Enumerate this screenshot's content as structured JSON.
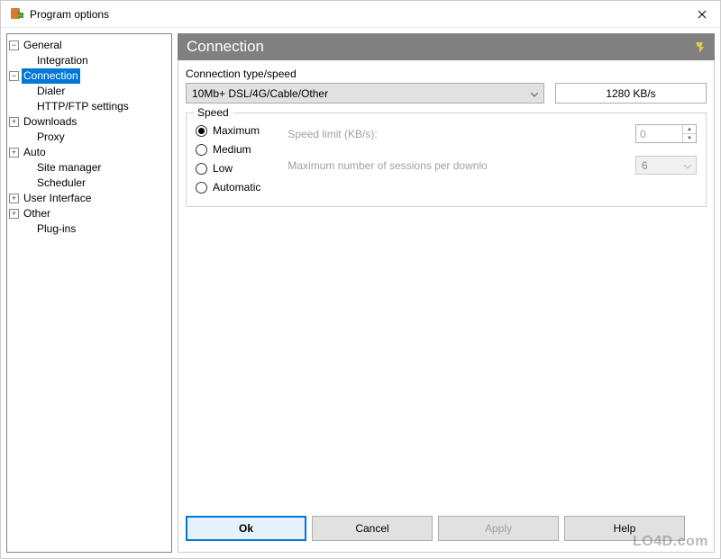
{
  "window": {
    "title": "Program options"
  },
  "tree": {
    "items": [
      {
        "label": "General",
        "depth": 0,
        "expander": "−"
      },
      {
        "label": "Integration",
        "depth": 1,
        "expander": ""
      },
      {
        "label": "Connection",
        "depth": 0,
        "expander": "−",
        "selected": true
      },
      {
        "label": "Dialer",
        "depth": 1,
        "expander": ""
      },
      {
        "label": "HTTP/FTP settings",
        "depth": 1,
        "expander": ""
      },
      {
        "label": "Downloads",
        "depth": 0,
        "expander": "+"
      },
      {
        "label": "Proxy",
        "depth": 1,
        "expander": ""
      },
      {
        "label": "Auto",
        "depth": 0,
        "expander": "+"
      },
      {
        "label": "Site manager",
        "depth": 1,
        "expander": ""
      },
      {
        "label": "Scheduler",
        "depth": 1,
        "expander": ""
      },
      {
        "label": "User Interface",
        "depth": 0,
        "expander": "+"
      },
      {
        "label": "Other",
        "depth": 0,
        "expander": "+"
      },
      {
        "label": "Plug-ins",
        "depth": 1,
        "expander": ""
      }
    ]
  },
  "header": {
    "title": "Connection"
  },
  "connType": {
    "label": "Connection type/speed",
    "value": "10Mb+ DSL/4G/Cable/Other",
    "rate": "1280 KB/s"
  },
  "speed": {
    "legend": "Speed",
    "options": [
      {
        "label": "Maximum",
        "selected": true
      },
      {
        "label": "Medium",
        "selected": false
      },
      {
        "label": "Low",
        "selected": false
      },
      {
        "label": "Automatic",
        "selected": false
      }
    ],
    "limitLabel": "Speed limit (KB/s):",
    "limitValue": "0",
    "sessionsLabel": "Maximum number of sessions per downlo",
    "sessionsValue": "6"
  },
  "buttons": {
    "ok": "Ok",
    "cancel": "Cancel",
    "apply": "Apply",
    "help": "Help"
  },
  "watermark": "LO4D.com"
}
